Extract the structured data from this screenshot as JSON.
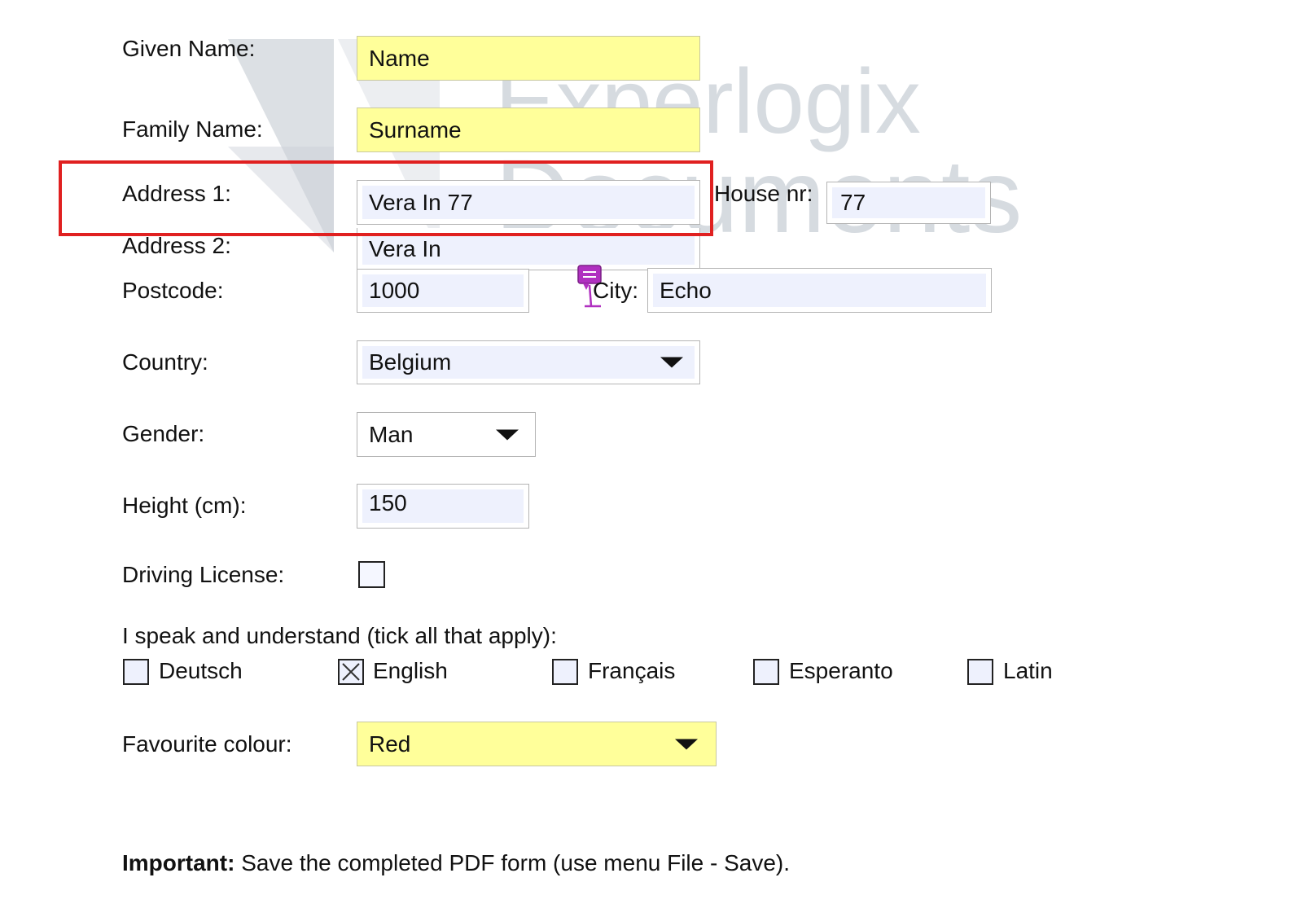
{
  "watermark": {
    "line1": "Experlogix",
    "line2": "Documents"
  },
  "form": {
    "given_name": {
      "label": "Given Name:",
      "value": "Name"
    },
    "family_name": {
      "label": "Family Name:",
      "value": "Surname"
    },
    "address1": {
      "label": "Address 1:",
      "value": "Vera In 77"
    },
    "house_nr": {
      "label": "House nr:",
      "value": "77"
    },
    "address2": {
      "label": "Address 2:",
      "value": "Vera In"
    },
    "postcode": {
      "label": "Postcode:",
      "value": "1000"
    },
    "city": {
      "label": "City:",
      "value": "Echo"
    },
    "country": {
      "label": "Country:",
      "value": "Belgium"
    },
    "gender": {
      "label": "Gender:",
      "value": "Man"
    },
    "height": {
      "label": "Height (cm):",
      "value": "150"
    },
    "driving_license": {
      "label": "Driving License:",
      "checked": false
    },
    "languages": {
      "label": "I speak and understand (tick all that apply):",
      "options": [
        {
          "label": "Deutsch",
          "checked": false
        },
        {
          "label": "English",
          "checked": true
        },
        {
          "label": "Français",
          "checked": false
        },
        {
          "label": "Esperanto",
          "checked": false
        },
        {
          "label": "Latin",
          "checked": false
        }
      ]
    },
    "favourite_colour": {
      "label": "Favourite colour:",
      "value": "Red"
    }
  },
  "footer": {
    "bold": "Important:",
    "text": " Save the completed PDF form (use menu File - Save)."
  },
  "colors": {
    "highlight_box": "#e02020",
    "required_field": "#ffff9a",
    "field_fill": "#eef1fd",
    "note_icon": "#b030c0"
  },
  "icons": {
    "note": "comment-note-icon",
    "dropdown": "caret-down-icon",
    "checked": "x-mark-icon"
  }
}
